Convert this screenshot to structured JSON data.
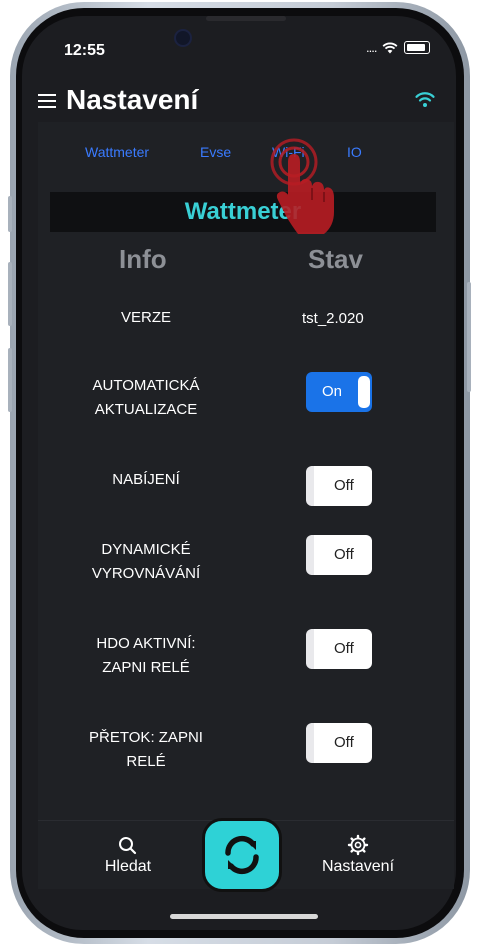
{
  "status_bar": {
    "time": "12:55",
    "signal_dots": "...."
  },
  "header": {
    "title": "Nastavení"
  },
  "tabs": [
    {
      "label": "Wattmeter"
    },
    {
      "label": "Evse"
    },
    {
      "label": "Wi-Fi"
    },
    {
      "label": "IO"
    }
  ],
  "section": {
    "title": "Wattmeter"
  },
  "columns": {
    "info": "Info",
    "state": "Stav"
  },
  "rows": [
    {
      "label_line1": "VERZE",
      "label_line2": "",
      "value": "tst_2.020"
    },
    {
      "label_line1": "AUTOMATICKÁ",
      "label_line2": "AKTUALIZACE",
      "toggle": "On"
    },
    {
      "label_line1": "NABÍJENÍ",
      "label_line2": "",
      "toggle": "Off"
    },
    {
      "label_line1": "DYNAMICKÉ",
      "label_line2": "VYROVNÁVÁNÍ",
      "toggle": "Off"
    },
    {
      "label_line1": "HDO AKTIVNÍ:",
      "label_line2": "ZAPNI RELÉ",
      "toggle": "Off"
    },
    {
      "label_line1": "PŘETOK: ZAPNI",
      "label_line2": "RELÉ",
      "toggle": "Off"
    }
  ],
  "bottom_nav": {
    "search_label": "Hledat",
    "settings_label": "Nastavení"
  },
  "icons": {
    "menu": "menu-icon",
    "wifi": "wifi-icon",
    "search": "search-icon",
    "refresh": "refresh-icon",
    "settings": "gear-icon",
    "tap": "tap-hand-icon"
  },
  "colors": {
    "accent_teal": "#39d0d5",
    "tab_blue": "#3a7bff",
    "toggle_on": "#1a73e8",
    "background": "#1c1d21"
  }
}
